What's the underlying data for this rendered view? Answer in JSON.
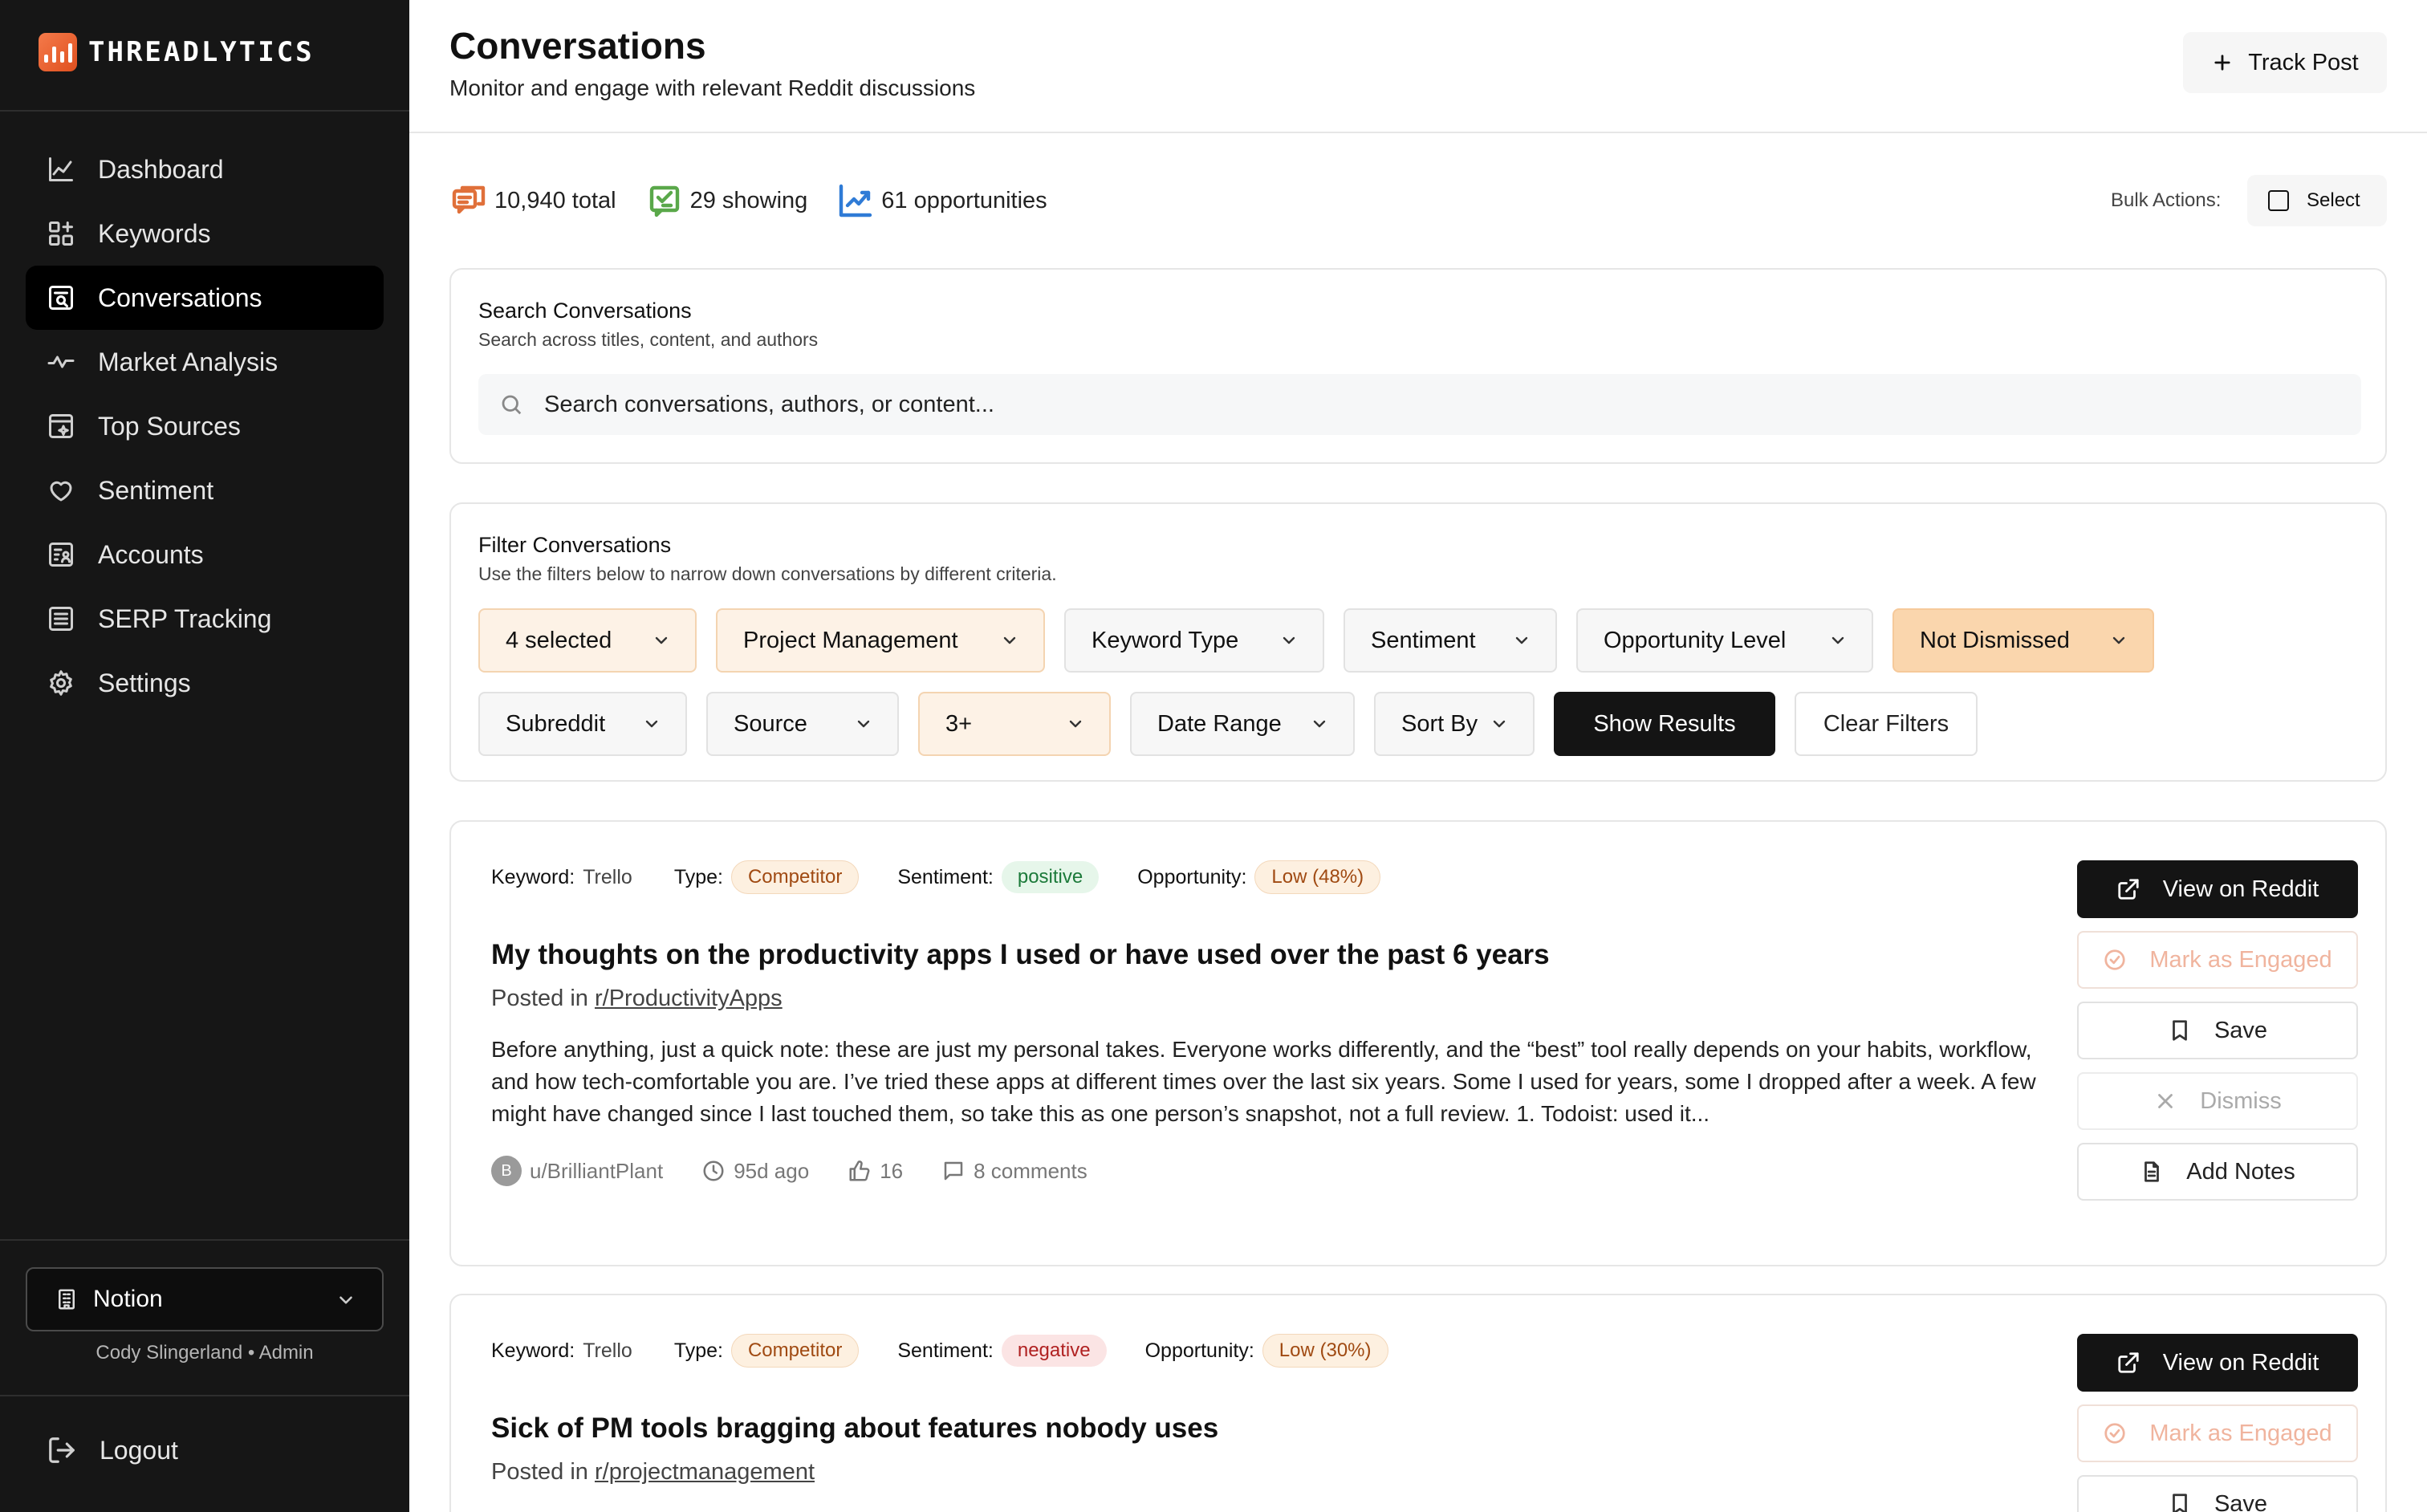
{
  "brand": {
    "name": "THREADLYTICS"
  },
  "sidebar": {
    "items": [
      {
        "label": "Dashboard",
        "icon": "chart-line-icon"
      },
      {
        "label": "Keywords",
        "icon": "grid-icon"
      },
      {
        "label": "Conversations",
        "icon": "search-document-icon",
        "active": true
      },
      {
        "label": "Market Analysis",
        "icon": "activity-icon"
      },
      {
        "label": "Top Sources",
        "icon": "sparkle-window-icon"
      },
      {
        "label": "Sentiment",
        "icon": "heart-icon"
      },
      {
        "label": "Accounts",
        "icon": "accounts-icon"
      },
      {
        "label": "SERP Tracking",
        "icon": "list-icon"
      },
      {
        "label": "Settings",
        "icon": "gear-icon"
      }
    ],
    "workspace": "Notion",
    "user": "Cody Slingerland • Admin",
    "logout": "Logout"
  },
  "header": {
    "title": "Conversations",
    "subtitle": "Monitor and engage with relevant Reddit discussions",
    "track_post": "Track Post"
  },
  "stats": {
    "total": "10,940 total",
    "showing": "29 showing",
    "opportunities": "61 opportunities",
    "bulk_label": "Bulk Actions:",
    "select_label": "Select"
  },
  "search": {
    "title": "Search Conversations",
    "description": "Search across titles, content, and authors",
    "placeholder": "Search conversations, authors, or content..."
  },
  "filters": {
    "title": "Filter Conversations",
    "description": "Use the filters below to narrow down conversations by different criteria.",
    "row1": [
      "4 selected",
      "Project Management",
      "Keyword Type",
      "Sentiment",
      "Opportunity Level",
      "Not Dismissed"
    ],
    "row2": [
      "Subreddit",
      "Source",
      "3+",
      "Date Range",
      "Sort By"
    ],
    "show_results": "Show Results",
    "clear_filters": "Clear Filters"
  },
  "meta_labels": {
    "keyword": "Keyword:",
    "type": "Type:",
    "sentiment": "Sentiment:",
    "opportunity": "Opportunity:",
    "posted_in": "Posted in"
  },
  "actions": {
    "view": "View on Reddit",
    "engaged": "Mark as Engaged",
    "save": "Save",
    "dismiss": "Dismiss",
    "notes": "Add Notes"
  },
  "posts": [
    {
      "keyword": "Trello",
      "type": "Competitor",
      "sentiment": "positive",
      "opportunity": "Low (48%)",
      "title": "My thoughts on the productivity apps I used or have used over the past 6 years",
      "subreddit": "r/ProductivityApps",
      "body": "Before anything, just a quick note: these are just my personal takes. Everyone works differently, and the “best” tool really depends on your habits, workflow, and how tech-comfortable you are. I’ve tried these apps at different times over the last six years. Some I used for years, some I dropped after a week. A few might have changed since I last touched them, so take this as one person’s snapshot, not a full review. 1. Todoist: used it...",
      "avatar_letter": "B",
      "author": "u/BrilliantPlant",
      "age": "95d ago",
      "upvotes": "16",
      "comments": "8 comments"
    },
    {
      "keyword": "Trello",
      "type": "Competitor",
      "sentiment": "negative",
      "opportunity": "Low (30%)",
      "title": "Sick of PM tools bragging about features nobody uses",
      "subreddit": "r/projectmanagement"
    }
  ],
  "colors": {
    "accent": "#e0501f",
    "sidebar_bg": "#161616",
    "filter_active": "#fad6ad"
  }
}
